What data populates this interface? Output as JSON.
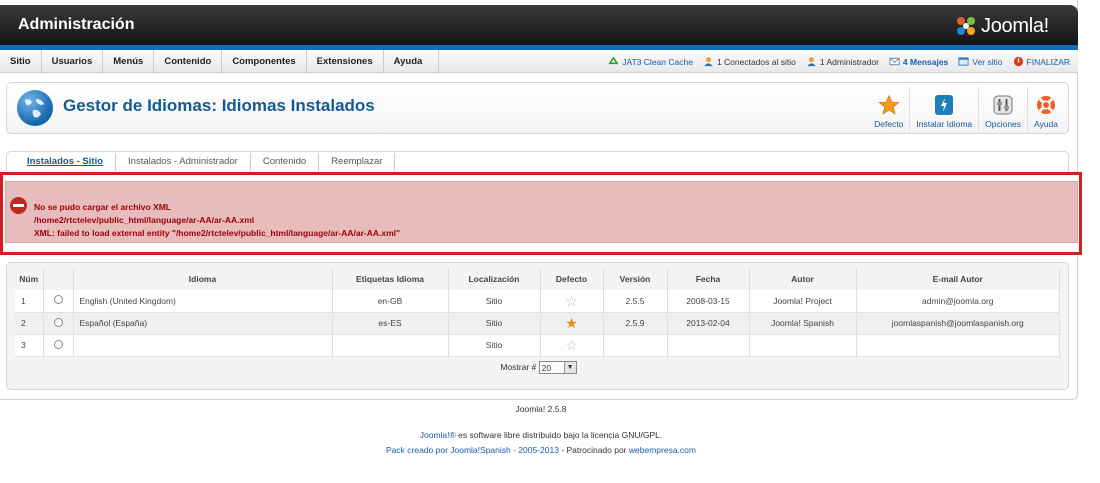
{
  "header": {
    "title": "Administración",
    "logo_text": "Joomla!"
  },
  "menu": [
    "Sitio",
    "Usuarios",
    "Menús",
    "Contenido",
    "Componentes",
    "Extensiones",
    "Ayuda"
  ],
  "status": {
    "cache": "JAT3 Clean Cache",
    "online": "1 Conectados al sitio",
    "admins": "1 Administrador",
    "messages": "4 Mensajes",
    "view_site": "Ver sitio",
    "logout": "FINALIZAR"
  },
  "page": {
    "title": "Gestor de Idiomas: Idiomas Instalados"
  },
  "toolbar": [
    {
      "label": "Defecto",
      "icon": "star-icon"
    },
    {
      "label": "Instalar Idioma",
      "icon": "install-icon"
    },
    {
      "label": "Opciones",
      "icon": "options-icon"
    },
    {
      "label": "Ayuda",
      "icon": "help-icon"
    }
  ],
  "tabs": [
    "Instalados - Sitio",
    "Instalados - Administrador",
    "Contenido",
    "Reemplazar"
  ],
  "error": {
    "line1": "No se pudo cargar el archivo XML",
    "line2": "/home2/rtctelev/public_html/language/ar-AA/ar-AA.xml",
    "line3": "XML: failed to load external entity \"/home2/rtctelev/public_html/language/ar-AA/ar-AA.xml\""
  },
  "table": {
    "headers": [
      "Núm",
      "",
      "Idioma",
      "Etiquetas Idioma",
      "Localización",
      "Defecto",
      "Versión",
      "Fecha",
      "Autor",
      "E-mail Autor"
    ],
    "rows": [
      {
        "num": "1",
        "language": "English (United Kingdom)",
        "tag": "en-GB",
        "location": "Sitio",
        "default": false,
        "version": "2.5.5",
        "date": "2008-03-15",
        "author": "Joomla! Project",
        "email": "admin@joomla.org"
      },
      {
        "num": "2",
        "language": "Español (España)",
        "tag": "es-ES",
        "location": "Sitio",
        "default": true,
        "version": "2.5.9",
        "date": "2013-02-04",
        "author": "Joomla! Spanish",
        "email": "joomlaspanish@joomlaspanish.org"
      },
      {
        "num": "3",
        "language": "",
        "tag": "",
        "location": "Sitio",
        "default": false,
        "version": "",
        "date": "",
        "author": "",
        "email": ""
      }
    ]
  },
  "pager": {
    "label": "Mostrar #",
    "value": "20"
  },
  "footer": {
    "version": "Joomla! 2.5.8",
    "license_link": "Joomla!®",
    "license_text": " es software libre distribuido bajo la licencia GNU/GPL.",
    "pack_link": "Pack creado por Joomla!Spanish - 2005-2013",
    "pack_text": " - Patrocinado por ",
    "sponsor_link": "webempresa.com"
  }
}
